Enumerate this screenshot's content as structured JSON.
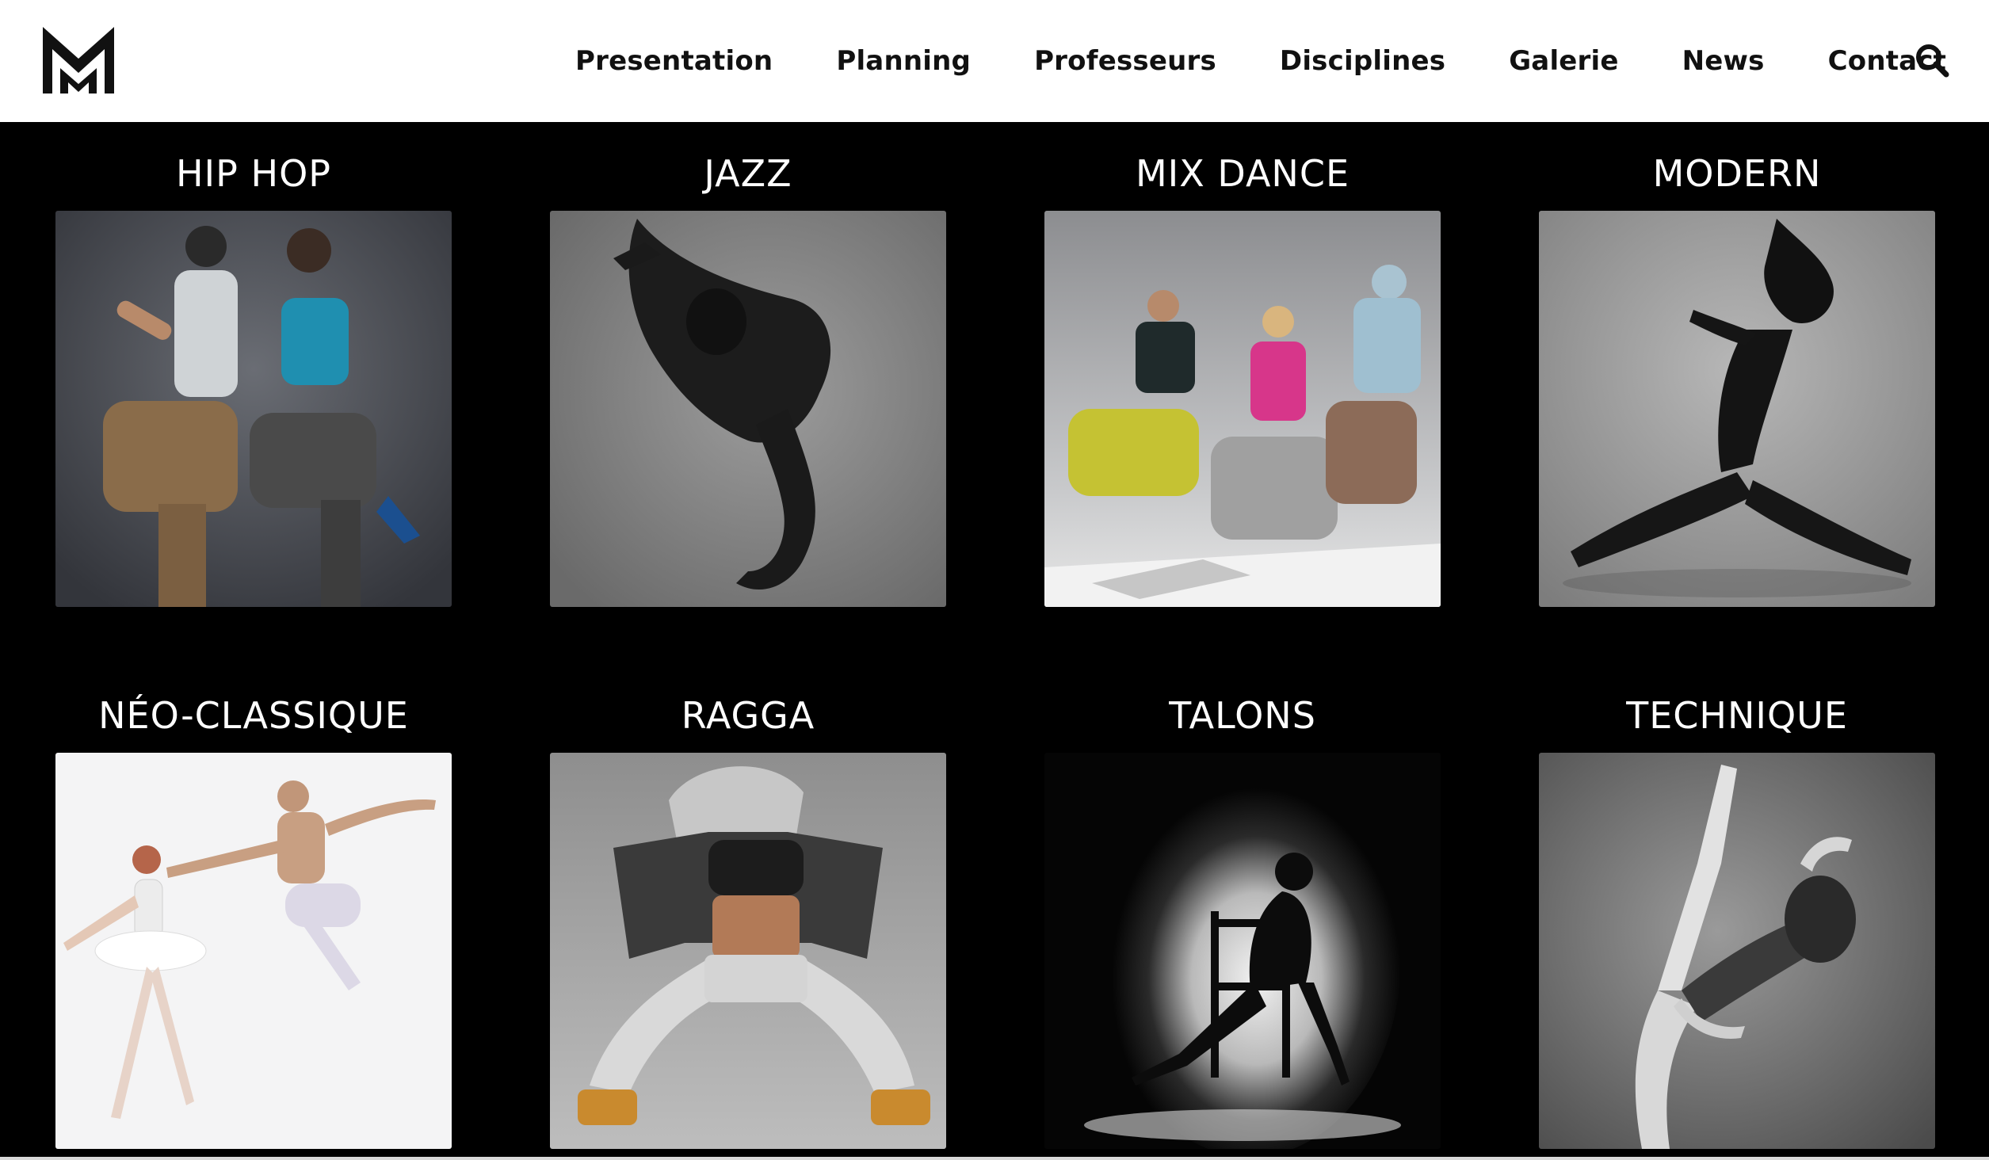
{
  "brand": {
    "logo_icon": "mm-monogram-logo"
  },
  "nav": {
    "items": [
      {
        "label": "Presentation"
      },
      {
        "label": "Planning"
      },
      {
        "label": "Professeurs"
      },
      {
        "label": "Disciplines"
      },
      {
        "label": "Galerie"
      },
      {
        "label": "News"
      },
      {
        "label": "Contact"
      }
    ],
    "search_icon": "search-icon"
  },
  "disciplines": [
    {
      "title": "HIP HOP",
      "image": "hip-hop-dancers-photo"
    },
    {
      "title": "JAZZ",
      "image": "jazz-dancer-leap-photo"
    },
    {
      "title": "MIX DANCE",
      "image": "mix-dance-group-photo"
    },
    {
      "title": "MODERN",
      "image": "modern-dancer-lunge-photo"
    },
    {
      "title": "NÉO-CLASSIQUE",
      "image": "neo-classical-ballet-duo-photo"
    },
    {
      "title": "RAGGA",
      "image": "ragga-dancer-hood-photo"
    },
    {
      "title": "TALONS",
      "image": "heels-dancer-chair-silhouette-photo"
    },
    {
      "title": "TECHNIQUE",
      "image": "technique-dancer-high-kick-photo"
    }
  ],
  "colors": {
    "header_bg": "#ffffff",
    "page_bg": "#000000",
    "title_text": "#ffffff",
    "nav_text": "#111111"
  }
}
